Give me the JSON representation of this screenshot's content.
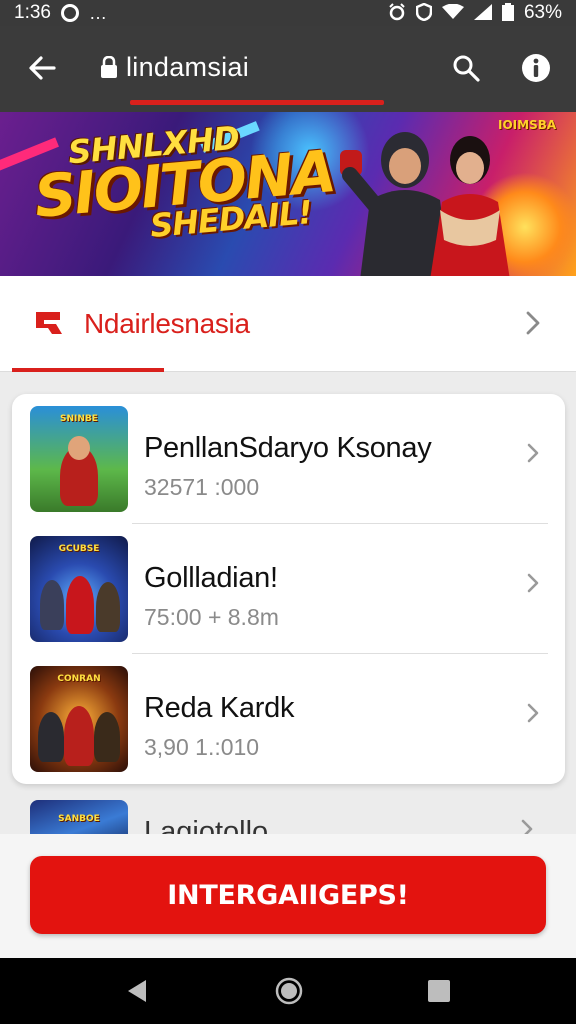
{
  "status_bar": {
    "time": "1:36",
    "more": "…",
    "battery": "63%"
  },
  "toolbar": {
    "title": "lindamsiai",
    "icons": [
      "back-arrow-icon",
      "lock-icon",
      "search-icon",
      "info-icon"
    ]
  },
  "banner": {
    "line1": "SHNLXHD",
    "line2": "SIOITONA",
    "line3": "SHEDAIL!",
    "badge": "IOIMSBA"
  },
  "section": {
    "title": "Ndairlesnasia",
    "icon": "brand-logo-icon",
    "accent_color": "#d9201c"
  },
  "list": {
    "items": [
      {
        "title": "PenllanSdaryo Ksonay",
        "meta": "32571 :000",
        "thumb_label": "SNINBE"
      },
      {
        "title": "Gollladian!",
        "meta": "75:00 + 8.8m",
        "thumb_label": "GCUBSE"
      },
      {
        "title": "Reda Kardk",
        "meta": "3,90 1.:010",
        "thumb_label": "CONRAN"
      }
    ],
    "peek_item": {
      "title": "Lagiotollo",
      "thumb_label": "SANBOE"
    }
  },
  "cta": {
    "label": "INTERGAIIGEPS!",
    "color": "#e3130f"
  },
  "nav_bar": {
    "icons": [
      "back-triangle-icon",
      "home-circle-icon",
      "recents-square-icon"
    ]
  }
}
